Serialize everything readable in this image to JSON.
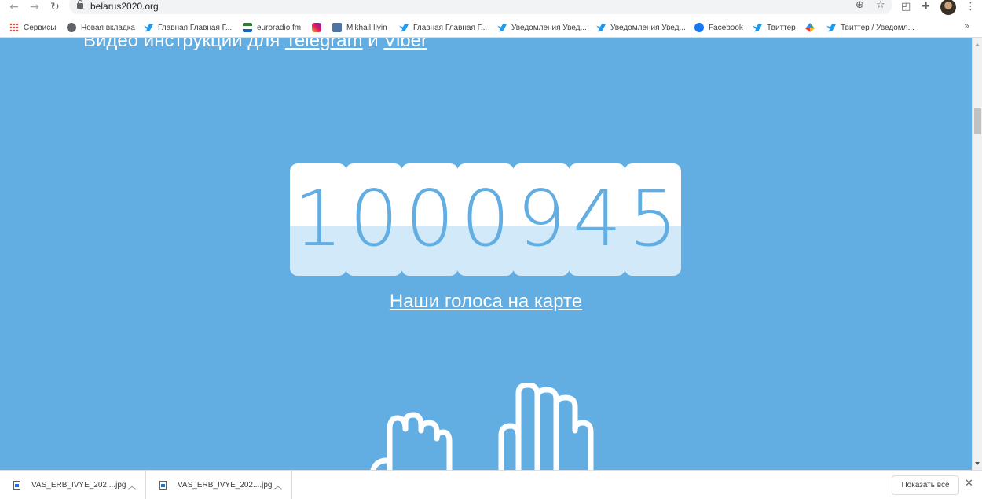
{
  "browser": {
    "url": "belarus2020.org",
    "icons": [
      "back-icon",
      "forward-icon",
      "reload-icon",
      "lock-icon",
      "zoom-icon",
      "star-icon",
      "pocket-icon",
      "extensions-icon",
      "menu-icon"
    ]
  },
  "bookmarks": [
    {
      "label": "Сервисы",
      "icon": "apps-icon"
    },
    {
      "label": "Новая вкладка",
      "icon": "globe-icon"
    },
    {
      "label": "Главная Главная Г...",
      "icon": "twitter-icon"
    },
    {
      "label": "euroradio.fm",
      "icon": "euroradio-icon"
    },
    {
      "label": "",
      "icon": "instagram-icon"
    },
    {
      "label": "Mikhail Ilyin",
      "icon": "vk-icon"
    },
    {
      "label": "Главная Главная Г...",
      "icon": "twitter-icon"
    },
    {
      "label": "Уведомления Увед...",
      "icon": "twitter-icon"
    },
    {
      "label": "Уведомления Увед...",
      "icon": "twitter-icon"
    },
    {
      "label": "Facebook",
      "icon": "facebook-icon"
    },
    {
      "label": "Твиттер",
      "icon": "twitter-icon"
    },
    {
      "label": "",
      "icon": "leaf-icon"
    },
    {
      "label": "Твиттер / Уведомл...",
      "icon": "twitter-icon"
    }
  ],
  "bookmarks_more": "»",
  "page": {
    "video_prefix": "Видео инструкции для ",
    "telegram_link": "Telegram",
    "conjunction": " и ",
    "viber_link": "Viber",
    "counter_digits": [
      "1",
      "0",
      "0",
      "0",
      "9",
      "4",
      "5"
    ],
    "map_link": "Наши голоса на карте"
  },
  "downloads": {
    "files": [
      {
        "name": "VAS_ERB_IVYE_202....jpg"
      },
      {
        "name": "VAS_ERB_IVYE_202....jpg"
      }
    ],
    "show_all_label": "Показать все",
    "close_label": "✕"
  },
  "colors": {
    "page_background": "#62ade1",
    "digit_text": "#62ade1"
  }
}
